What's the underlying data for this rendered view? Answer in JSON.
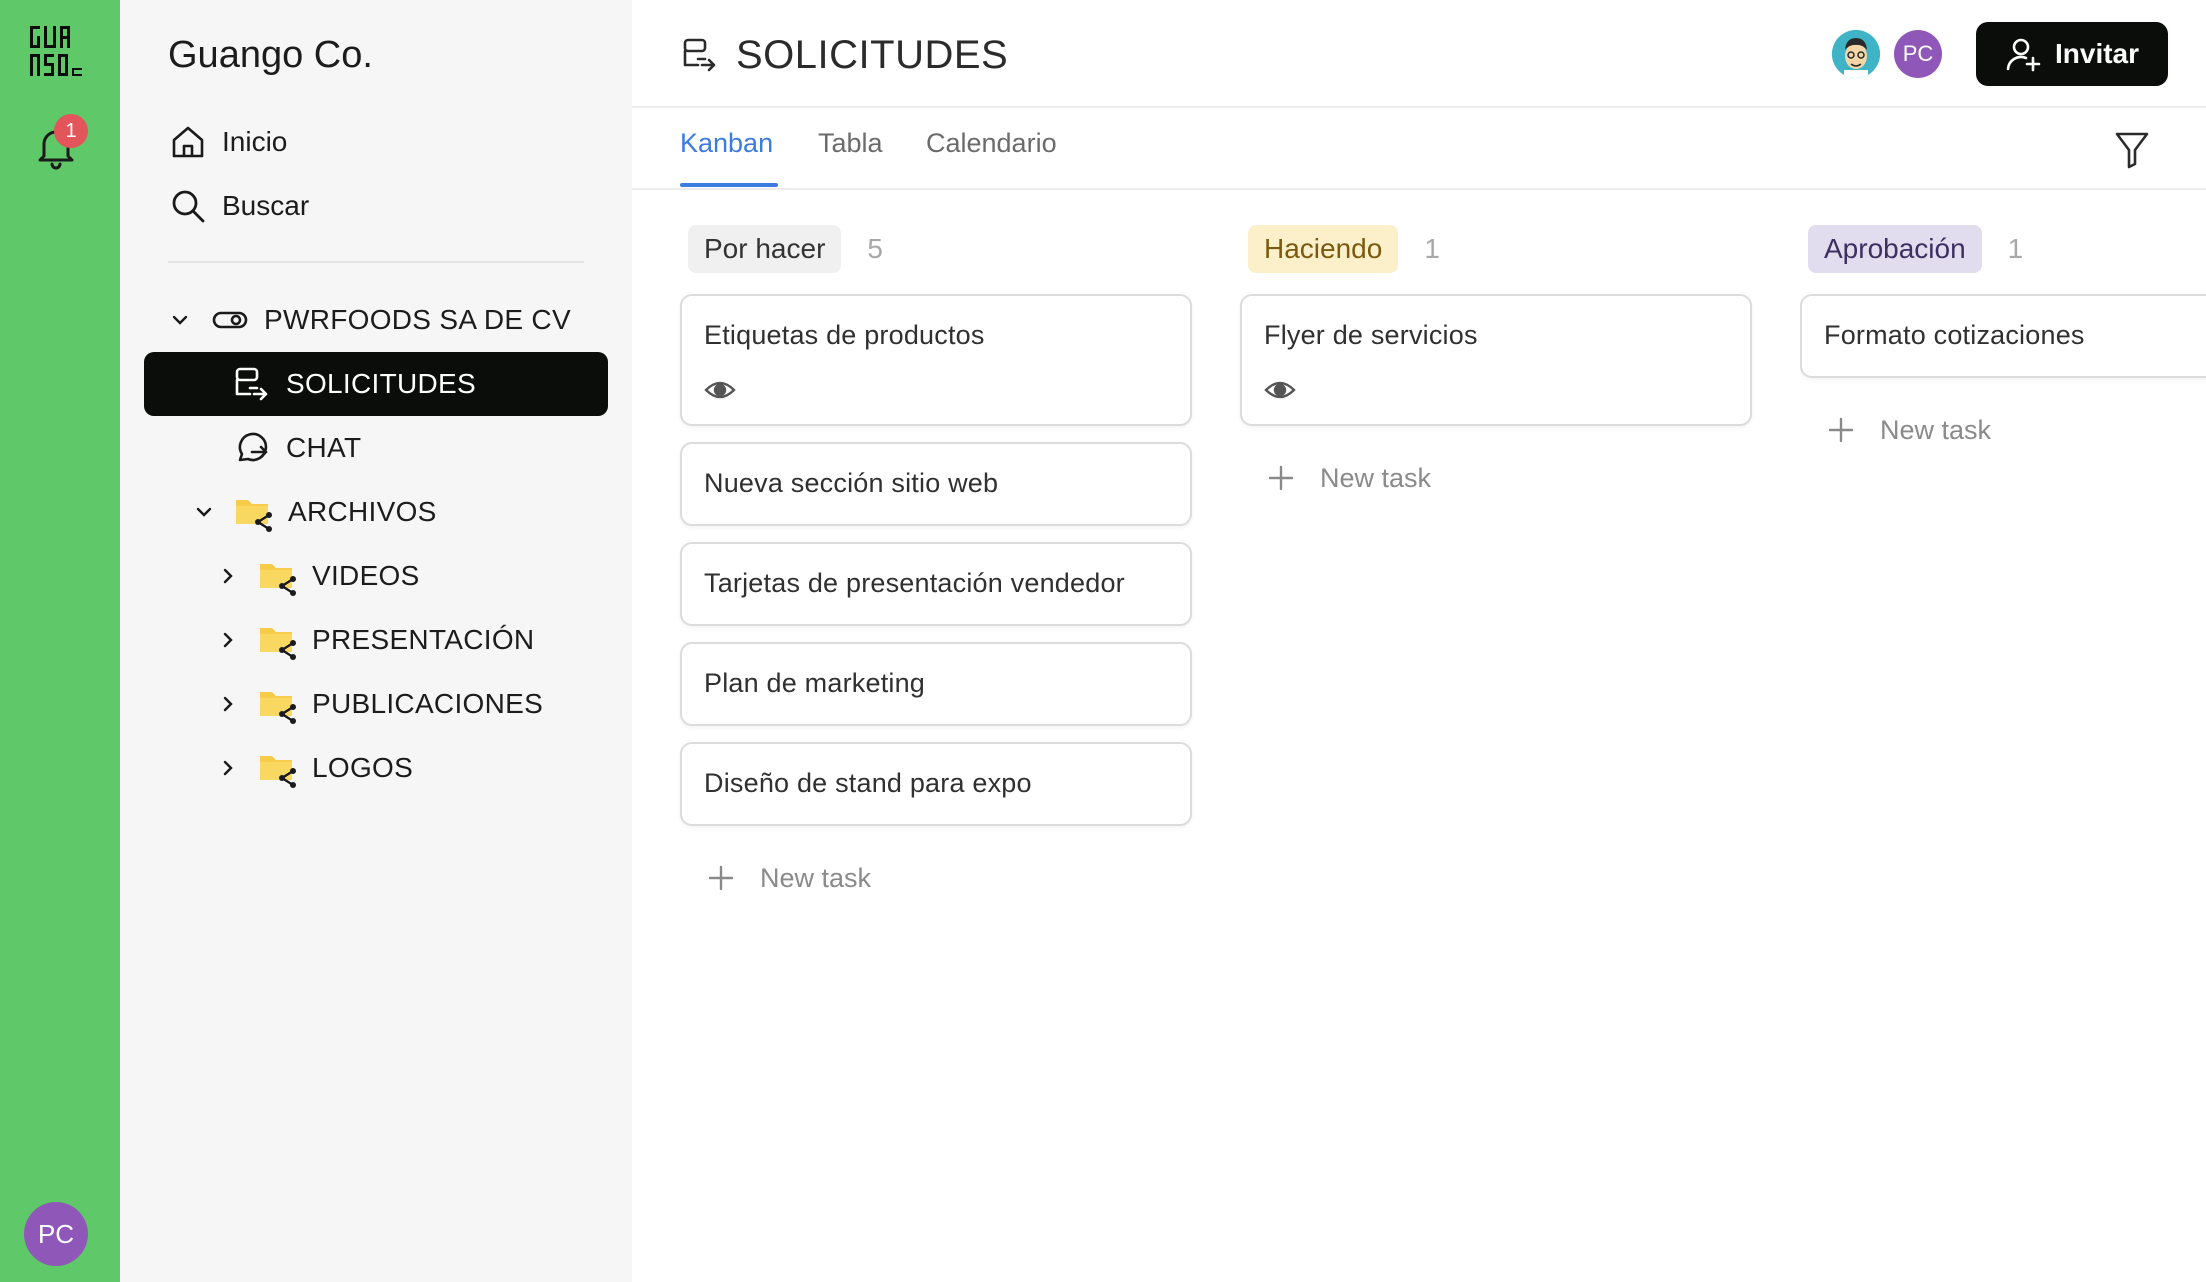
{
  "workspace": {
    "name": "Guango Co.",
    "logo_text": "GUANGO Co"
  },
  "rail": {
    "notifications_count": "1",
    "user_initials": "PC"
  },
  "sidebar": {
    "nav": [
      {
        "label": "Inicio",
        "icon": "home-icon"
      },
      {
        "label": "Buscar",
        "icon": "search-icon"
      }
    ],
    "tree": {
      "client": "PWRFOODS SA DE CV",
      "items": [
        {
          "label": "SOLICITUDES",
          "icon": "requests-icon",
          "active": true
        },
        {
          "label": "CHAT",
          "icon": "chat-icon"
        },
        {
          "label": "ARCHIVOS",
          "icon": "shared-folder-icon",
          "expanded": true
        },
        {
          "label": "VIDEOS",
          "icon": "shared-folder-icon"
        },
        {
          "label": "PRESENTACIÓN",
          "icon": "shared-folder-icon"
        },
        {
          "label": "PUBLICACIONES",
          "icon": "shared-folder-icon"
        },
        {
          "label": "LOGOS",
          "icon": "shared-folder-icon"
        }
      ]
    }
  },
  "header": {
    "title": "SOLICITUDES",
    "avatar_initials": "PC",
    "invite_label": "Invitar"
  },
  "tabs": [
    {
      "label": "Kanban",
      "active": true
    },
    {
      "label": "Tabla"
    },
    {
      "label": "Calendario"
    }
  ],
  "colors": {
    "rail": "#5fc96a",
    "accent": "#3c7be0",
    "todo_pill": "#f0f0f0",
    "doing_pill": "#fbf0c9",
    "doing_text": "#7a5a10",
    "approval_pill": "#e2dcef",
    "approval_text": "#3c3060"
  },
  "board": {
    "new_task_label": "New task",
    "columns": [
      {
        "name": "Por hacer",
        "count": "5",
        "cards": [
          {
            "title": "Etiquetas de productos",
            "watched": true
          },
          {
            "title": "Nueva sección sitio web"
          },
          {
            "title": "Tarjetas de presentación vendedor"
          },
          {
            "title": "Plan de marketing"
          },
          {
            "title": "Diseño de stand para expo"
          }
        ]
      },
      {
        "name": "Haciendo",
        "count": "1",
        "cards": [
          {
            "title": "Flyer de servicios",
            "watched": true
          }
        ]
      },
      {
        "name": "Aprobación",
        "count": "1",
        "cards": [
          {
            "title": "Formato cotizaciones"
          }
        ]
      }
    ]
  }
}
